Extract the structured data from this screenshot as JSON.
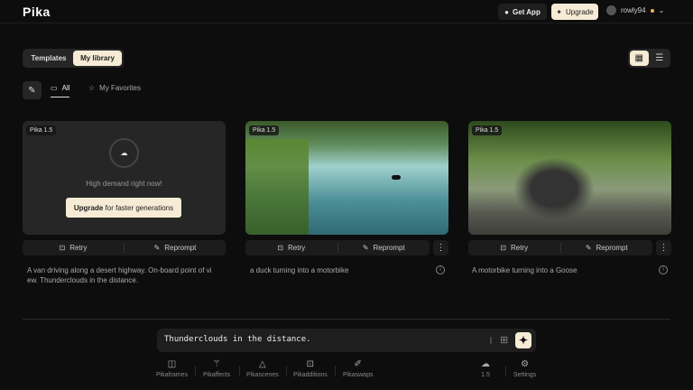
{
  "header": {
    "logo": "Pika",
    "get_app": "Get App",
    "upgrade": "Upgrade",
    "username": "rowly94"
  },
  "library": {
    "tabs": [
      "Templates",
      "My library"
    ],
    "filters": [
      "All",
      "My Favorites"
    ]
  },
  "cards": [
    {
      "badge": "Pika 1.5",
      "status": "High demand right now!",
      "upgrade_bold": "Upgrade",
      "upgrade_rest": " for faster generations",
      "retry": "Retry",
      "reprompt": "Reprompt",
      "caption": "A van driving along a desert highway. On-board point of vi ew. Thunderclouds in the distance."
    },
    {
      "badge": "Pika 1.5",
      "retry": "Retry",
      "reprompt": "Reprompt",
      "caption": "a duck turning into a motorbike"
    },
    {
      "badge": "Pika 1.5",
      "retry": "Retry",
      "reprompt": "Reprompt",
      "caption": "A motorbike turning into a Goose"
    }
  ],
  "prompt": {
    "value": "Thunderclouds in the distance."
  },
  "toolbar": {
    "items": [
      "Pikaframes",
      "Pikaffects",
      "Pikascenes",
      "Pikadditions",
      "Pikaswaps"
    ],
    "model": "1.5",
    "settings": "Settings"
  }
}
